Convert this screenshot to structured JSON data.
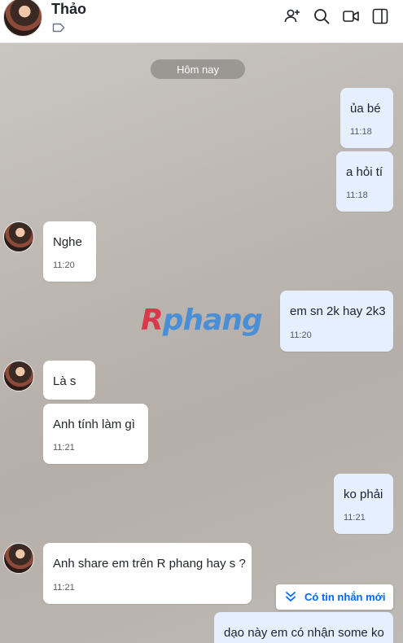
{
  "header": {
    "contact_name": "Thảo",
    "icons": [
      "tag-icon",
      "add-friend-icon",
      "search-icon",
      "video-call-icon",
      "sidebar-toggle-icon"
    ]
  },
  "chat": {
    "date_divider": "Hôm nay",
    "watermark": {
      "first": "R",
      "rest": "phang"
    },
    "messages": [
      {
        "from": "me",
        "text": "ủa bé",
        "time": "11:18"
      },
      {
        "from": "me",
        "text": "a hỏi tí",
        "time": "11:18"
      },
      {
        "from": "contact",
        "text": "Nghe",
        "time": "11:20"
      },
      {
        "from": "me",
        "text": "em sn 2k hay 2k3",
        "time": "11:20"
      },
      {
        "from": "contact",
        "text": "Là s",
        "time": ""
      },
      {
        "from": "contact",
        "text": "Anh tính làm gì",
        "time": "11:21"
      },
      {
        "from": "me",
        "text": "ko phải",
        "time": "11:21"
      },
      {
        "from": "contact",
        "text": "Anh share em trên R phang hay s ?",
        "time": "11:21"
      },
      {
        "from": "me",
        "text": "dạo này em có nhận some ko",
        "time": ""
      }
    ],
    "new_message_button": "Có tin nhắn mới"
  },
  "colors": {
    "my_bubble": "#e5efff",
    "contact_bubble": "#ffffff",
    "accent": "#0068ff"
  }
}
